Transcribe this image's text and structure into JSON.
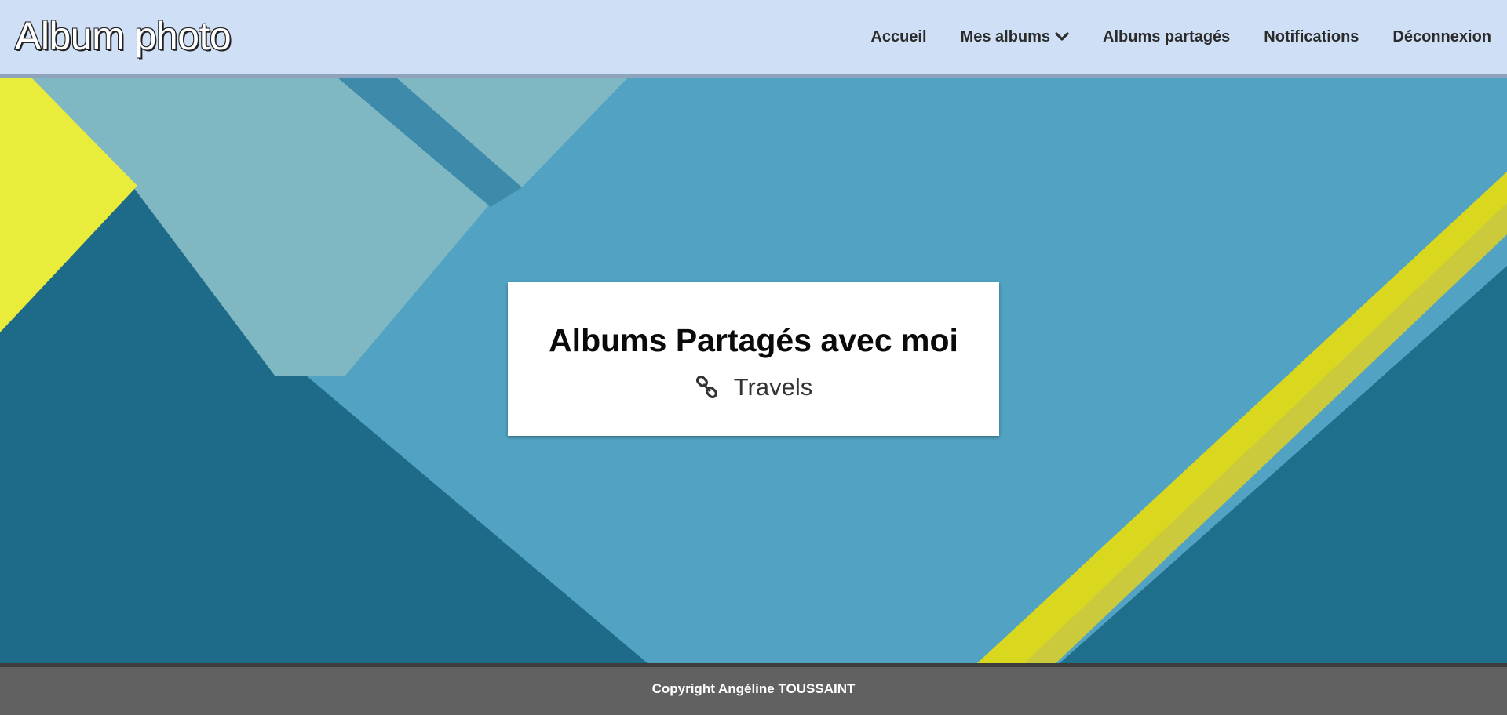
{
  "header": {
    "brand": "Album photo",
    "nav": [
      {
        "label": "Accueil"
      },
      {
        "label": "Mes albums",
        "icon": "chevron-down-icon"
      },
      {
        "label": "Albums partagés"
      },
      {
        "label": "Notifications"
      },
      {
        "label": "Déconnexion"
      }
    ]
  },
  "main": {
    "title": "Albums Partagés avec moi",
    "albums": [
      {
        "name": "Travels",
        "icon": "link-icon"
      }
    ]
  },
  "footer": {
    "copyright": "Copyright Angéline TOUSSAINT"
  },
  "colors": {
    "navbar_bg": "#cfe0f6",
    "footer_bg": "#616161",
    "hero_blue": "#4fa0c0",
    "hero_dark_teal": "#1f6b88",
    "hero_yellow": "#e3e22a"
  }
}
